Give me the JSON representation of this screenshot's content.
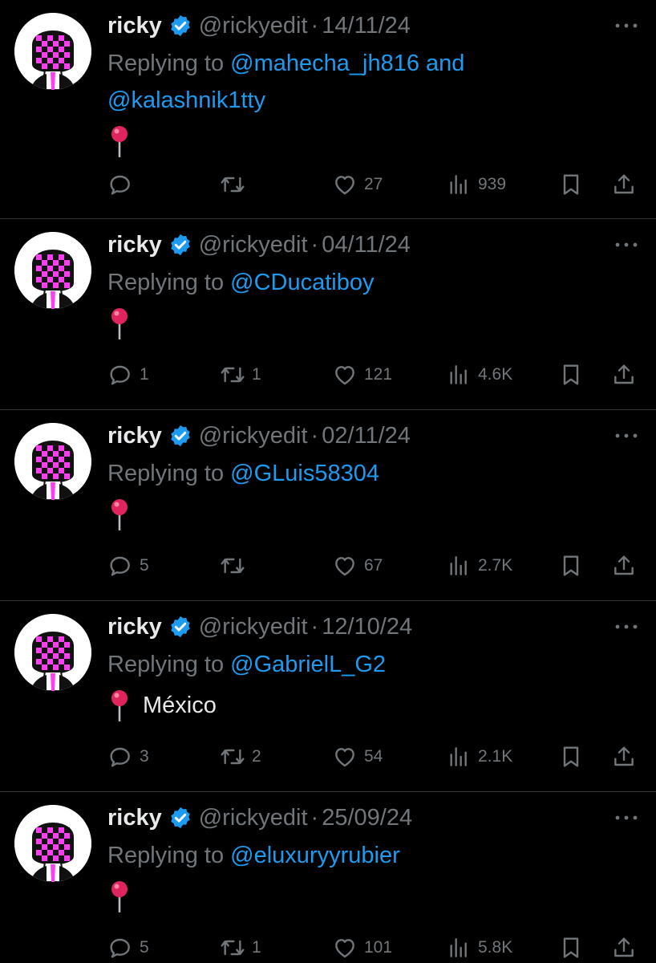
{
  "colors": {
    "background": "#000000",
    "text": "#e7e9ea",
    "muted": "#71767b",
    "link": "#1d9bf0",
    "verified": "#1d9bf0",
    "pin": "#e0245e",
    "avatar_pink": "#ff3df2"
  },
  "icons": {
    "verified": "verified-badge-icon",
    "more": "more-horizontal-icon",
    "pin": "round-pushpin-icon",
    "reply": "reply-icon",
    "retweet": "retweet-icon",
    "like": "like-icon",
    "views": "views-icon",
    "bookmark": "bookmark-icon",
    "share": "share-icon"
  },
  "tweets": [
    {
      "author": "ricky",
      "handle": "@rickyedit",
      "separator": "·",
      "date": "14/11/24",
      "replying_prefix": "Replying to ",
      "mentions": [
        "@mahecha_jh816",
        "@kalashnik1tty"
      ],
      "joiner": " and ",
      "body": "",
      "stats": {
        "replies": "",
        "retweets": "",
        "likes": "27",
        "views": "939"
      }
    },
    {
      "author": "ricky",
      "handle": "@rickyedit",
      "separator": "·",
      "date": "04/11/24",
      "replying_prefix": "Replying to ",
      "mentions": [
        "@CDucatiboy"
      ],
      "joiner": "",
      "body": "",
      "stats": {
        "replies": "1",
        "retweets": "1",
        "likes": "121",
        "views": "4.6K"
      }
    },
    {
      "author": "ricky",
      "handle": "@rickyedit",
      "separator": "·",
      "date": "02/11/24",
      "replying_prefix": "Replying to ",
      "mentions": [
        "@GLuis58304"
      ],
      "joiner": "",
      "body": "",
      "stats": {
        "replies": "5",
        "retweets": "",
        "likes": "67",
        "views": "2.7K"
      }
    },
    {
      "author": "ricky",
      "handle": "@rickyedit",
      "separator": "·",
      "date": "12/10/24",
      "replying_prefix": "Replying to ",
      "mentions": [
        "@GabrielL_G2"
      ],
      "joiner": "",
      "body": "México",
      "stats": {
        "replies": "3",
        "retweets": "2",
        "likes": "54",
        "views": "2.1K"
      }
    },
    {
      "author": "ricky",
      "handle": "@rickyedit",
      "separator": "·",
      "date": "25/09/24",
      "replying_prefix": "Replying to ",
      "mentions": [
        "@eluxuryyrubier"
      ],
      "joiner": "",
      "body": "",
      "stats": {
        "replies": "5",
        "retweets": "1",
        "likes": "101",
        "views": "5.8K"
      }
    }
  ]
}
